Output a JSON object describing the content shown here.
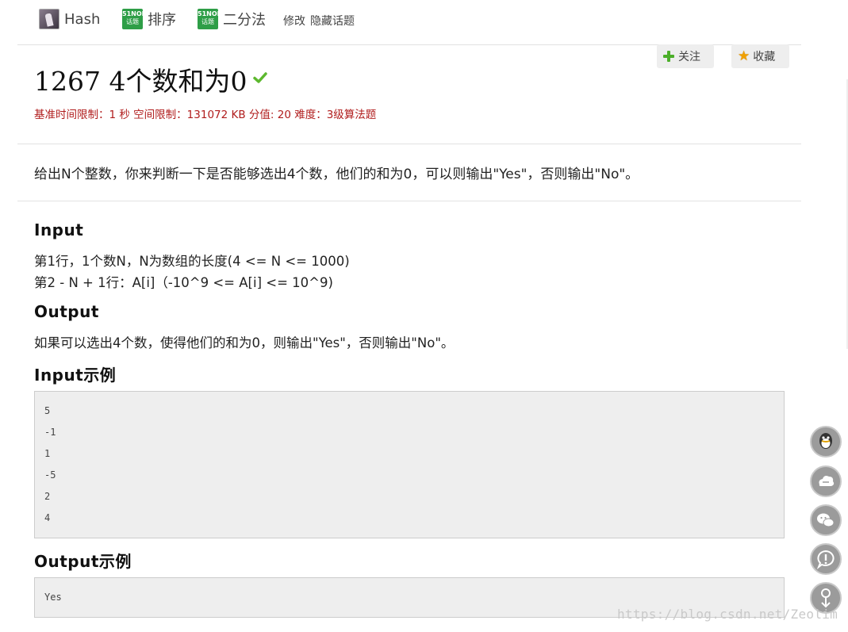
{
  "topbar": {
    "tags": [
      {
        "label": "Hash",
        "icon": "hash-topic-icon"
      },
      {
        "label": "排序",
        "icon": "51nod-topic-icon",
        "badge_top": "51NOD",
        "badge_bottom": "话题"
      },
      {
        "label": "二分法",
        "icon": "51nod-topic-icon",
        "badge_top": "51NOD",
        "badge_bottom": "话题"
      }
    ],
    "edit_label": "修改",
    "hide_topic_label": "隐藏话题"
  },
  "actions": {
    "follow_label": "关注",
    "favorite_label": "收藏"
  },
  "problem": {
    "title": "1267 4个数和为0",
    "limits": "基准时间限制：1 秒 空间限制：131072 KB 分值: 20 难度：3级算法题",
    "description": "给出N个整数，你来判断一下是否能够选出4个数，他们的和为0，可以则输出\"Yes\"，否则输出\"No\"。",
    "input_heading": "Input",
    "input_lines": [
      "第1行，1个数N，N为数组的长度(4 <= N <= 1000)",
      "第2 - N + 1行：A[i]（-10^9 <= A[i] <= 10^9)"
    ],
    "output_heading": "Output",
    "output_text": "如果可以选出4个数，使得他们的和为0，则输出\"Yes\"，否则输出\"No\"。",
    "input_example_heading": "Input示例",
    "input_example": [
      "5",
      "-1",
      "1",
      "-5",
      "2",
      "4"
    ],
    "output_example_heading": "Output示例",
    "output_example": [
      "Yes"
    ]
  },
  "colors": {
    "limits_text": "#b01c1c",
    "check": "#5cb82e",
    "code_bg": "#eeeeee",
    "float_button": "#9b9b9b"
  },
  "watermark": "https://blog.csdn.net/Zeolim"
}
